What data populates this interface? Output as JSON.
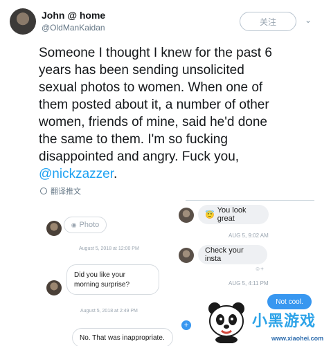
{
  "tweet": {
    "author_name": "John @ home",
    "author_handle": "@OldManKaidan",
    "follow_label": "关注",
    "text_lines": [
      "Someone I thought I knew for the past 6",
      "years has been sending unsolicited",
      "sexual photos to women. When one of",
      "them posted about it, a number of other",
      "women, friends of mine, said he'd done",
      "the same to them. I'm so fucking",
      "disappointed and angry. Fuck you,"
    ],
    "mention": "@nickzazzer",
    "mention_suffix": ".",
    "translate_label": "翻译推文"
  },
  "left_chat": {
    "photo_label": "Photo",
    "timestamp_1": "August 5, 2018 at 12:00 PM",
    "question": "Did you like your morning surprise?",
    "timestamp_2": "August 5, 2018 at 2:49 PM",
    "reply": "No. That was inappropriate."
  },
  "right_chat": {
    "msg_1": "You look great",
    "time_1": "AUG 5, 9:02 AM",
    "msg_2": "Check your insta",
    "time_2": "AUG 5, 4:11 PM",
    "msg_3": "Not cool."
  },
  "watermark": {
    "title": "小黑游戏",
    "url": "www.xiaohei.com"
  },
  "colors": {
    "accent": "#1da1f2",
    "dm_blue": "#3897f0"
  }
}
